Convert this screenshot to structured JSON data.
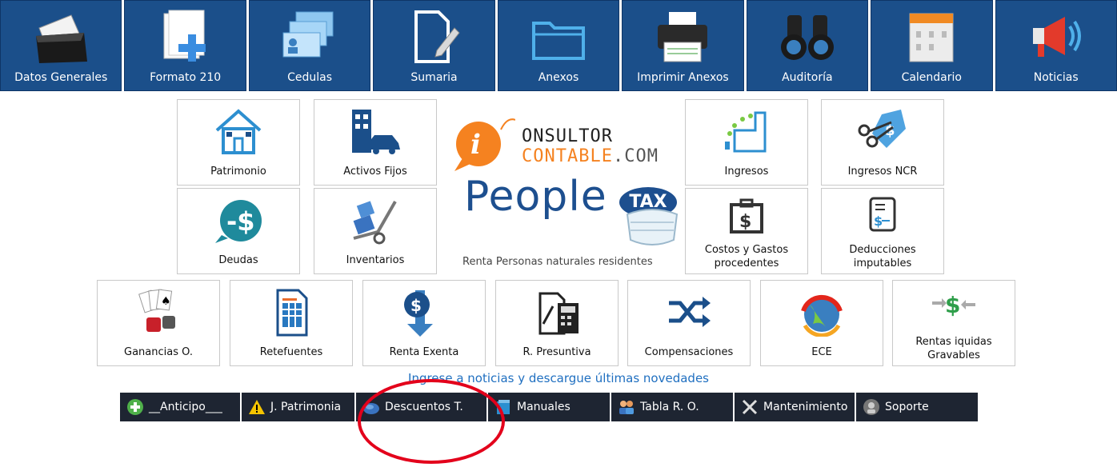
{
  "topnav": {
    "items": [
      {
        "label": "Datos Generales",
        "icon": "folder-documents-icon"
      },
      {
        "label": "Formato 210",
        "icon": "document-plus-icon"
      },
      {
        "label": "Cedulas",
        "icon": "id-cards-icon"
      },
      {
        "label": "Sumaria",
        "icon": "document-pencil-icon"
      },
      {
        "label": "Anexos",
        "icon": "folder-icon"
      },
      {
        "label": "Imprimir Anexos",
        "icon": "printer-icon"
      },
      {
        "label": "Auditoría",
        "icon": "binoculars-icon"
      },
      {
        "label": "Calendario",
        "icon": "calendar-icon"
      },
      {
        "label": "Noticias",
        "icon": "megaphone-icon"
      }
    ]
  },
  "tiles": {
    "patrimonio": "Patrimonio",
    "activos_fijos": "Activos Fijos",
    "ingresos": "Ingresos",
    "ingresos_ncr": "Ingresos NCR",
    "deudas": "Deudas",
    "inventarios": "Inventarios",
    "costos_gastos": "Costos y Gastos procedentes",
    "deducciones": "Deducciones imputables",
    "ganancias": "Ganancias O.",
    "retefuentes": "Retefuentes",
    "renta_exenta": "Renta Exenta",
    "r_presuntiva": "R. Presuntiva",
    "compensaciones": "Compensaciones",
    "ece": "ECE",
    "rentas_liquidas": "Rentas iquidas Gravables"
  },
  "logo": {
    "line1": "ONSULTOR",
    "line2a": "CONTABLE",
    "line2b": ".COM",
    "brand": "People",
    "brand_tail": "TAX",
    "subtitle": "Renta Personas naturales residentes"
  },
  "news_link": "Ingrese a noticias y descargue últimas novedades",
  "bottombar": {
    "items": [
      {
        "label": "__Anticipo___",
        "icon": "plus-circle-icon"
      },
      {
        "label": "J. Patrimonia",
        "icon": "warning-icon"
      },
      {
        "label": "Descuentos T.",
        "icon": "discount-icon"
      },
      {
        "label": "Manuales",
        "icon": "book-icon"
      },
      {
        "label": "Tabla R. O.",
        "icon": "users-icon"
      },
      {
        "label": "Mantenimiento",
        "icon": "tools-icon"
      },
      {
        "label": "Soporte",
        "icon": "support-icon"
      }
    ]
  },
  "colors": {
    "nav_bg": "#1b4f8a",
    "toolbar_bg": "#1e2532",
    "link": "#1f6fc0",
    "highlight": "#e3001b"
  }
}
